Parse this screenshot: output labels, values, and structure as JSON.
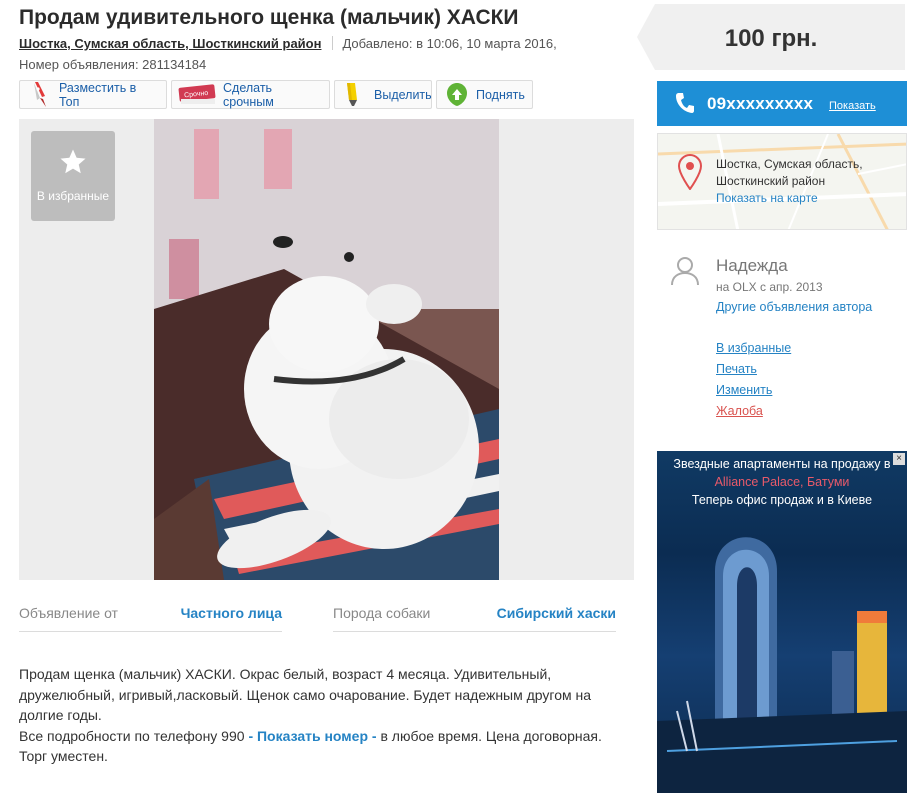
{
  "listing": {
    "title": "Продам удивительного щенка (мальчик) ХАСКИ",
    "location": "Шостка, Сумская область, Шосткинский район",
    "added": "Добавлено: в 10:06, 10 марта 2016,",
    "ad_number": "Номер объявления: 281134184"
  },
  "toolbar": {
    "top_label": "Разместить в Топ",
    "urgent_label": "Сделать срочным",
    "urgent_badge": "Срочно",
    "highlight_label": "Выделить",
    "raise_label": "Поднять"
  },
  "gallery": {
    "favorite_label": "В избранные"
  },
  "params": [
    {
      "key": "Объявление от",
      "value": "Частного лица"
    },
    {
      "key": "Порода собаки",
      "value": "Сибирский хаски"
    }
  ],
  "description": {
    "text": "Продам щенка (мальчик) ХАСКИ. Окрас белый, возраст 4 месяца. Удивительный, дружелюбный, игривый,ласковый. Щенок само очарование. Будет надежным другом на долгие годы.",
    "line2_start": "Все подробности по телефону 990",
    "show_number": "- Показать номер -",
    "line2_end": "в любое время. Цена договорная. Торг уместен."
  },
  "price": "100 грн.",
  "phone": {
    "number": "09xxxxxxxxx",
    "show_label": "Показать"
  },
  "map": {
    "address_line1": "Шостка, Сумская область,",
    "address_line2": "Шосткинский район",
    "show_on_map": "Показать на карте"
  },
  "seller": {
    "name": "Надежда",
    "since": "на OLX с апр. 2013",
    "other_ads": "Другие объявления автора"
  },
  "actions": [
    "В избранные",
    "Печать",
    "Изменить",
    "Жалоба"
  ],
  "ad_banner": {
    "line1": "Звездные апартаменты на продажу в",
    "line2": "Alliance Palace, Батуми",
    "line3": "Теперь офис продаж и в Киеве"
  },
  "colors": {
    "accent": "#1e8fd6",
    "link": "#2583c4",
    "complaint": "#d9534f"
  }
}
